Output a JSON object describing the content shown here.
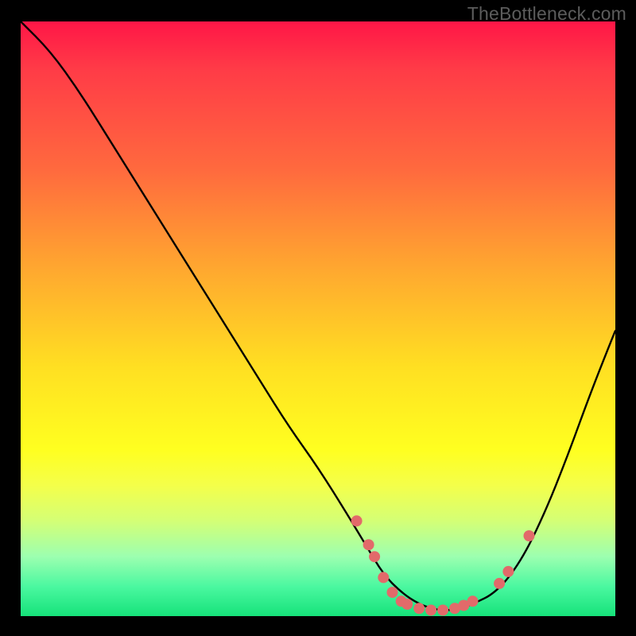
{
  "watermark": "TheBottleneck.com",
  "chart_data": {
    "type": "line",
    "title": "",
    "xlabel": "",
    "ylabel": "",
    "xlim": [
      0,
      100
    ],
    "ylim": [
      0,
      100
    ],
    "series": [
      {
        "name": "bottleneck-curve",
        "x": [
          0,
          5,
          10,
          15,
          20,
          25,
          30,
          35,
          40,
          45,
          50,
          55,
          58,
          61,
          64,
          67,
          70,
          73,
          76,
          80,
          84,
          88,
          92,
          96,
          100
        ],
        "y": [
          100,
          95,
          88,
          80,
          72,
          64,
          56,
          48,
          40,
          32,
          25,
          17,
          12,
          7,
          4,
          2,
          1,
          1,
          2,
          4,
          9,
          17,
          27,
          38,
          48
        ]
      }
    ],
    "markers": {
      "name": "highlighted-points",
      "color": "#e26a6a",
      "points": [
        {
          "x": 56.5,
          "y": 16
        },
        {
          "x": 58.5,
          "y": 12
        },
        {
          "x": 59.5,
          "y": 10
        },
        {
          "x": 61.0,
          "y": 6.5
        },
        {
          "x": 62.5,
          "y": 4.0
        },
        {
          "x": 64.0,
          "y": 2.5
        },
        {
          "x": 65.0,
          "y": 2.0
        },
        {
          "x": 67.0,
          "y": 1.3
        },
        {
          "x": 69.0,
          "y": 1.0
        },
        {
          "x": 71.0,
          "y": 1.0
        },
        {
          "x": 73.0,
          "y": 1.3
        },
        {
          "x": 74.5,
          "y": 1.8
        },
        {
          "x": 76.0,
          "y": 2.5
        },
        {
          "x": 80.5,
          "y": 5.5
        },
        {
          "x": 82.0,
          "y": 7.5
        },
        {
          "x": 85.5,
          "y": 13.5
        }
      ]
    }
  }
}
